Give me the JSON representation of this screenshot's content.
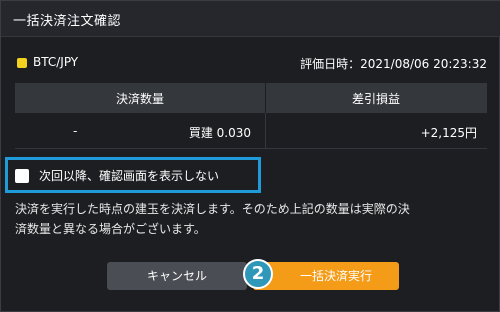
{
  "dialog": {
    "title": "一括決済注文確認"
  },
  "order": {
    "pair_color": "#f2d21e",
    "pair": "BTC/JPY",
    "valuation_time": "評価日時：2021/08/06 20:23:32"
  },
  "table": {
    "headers": [
      "決済数量",
      "差引損益"
    ],
    "row": {
      "dash": "-",
      "quantity": "買建 0.030",
      "profit_loss": "+2,125円"
    }
  },
  "option": {
    "checkbox_label": "次回以降、確認画面を表示しない",
    "checked": false,
    "highlight_color": "#1e9bd8"
  },
  "note": {
    "line1": "決済を実行した時点の建玉を決済します。そのため上記の数量は実際の決",
    "line2": "済数量と異なる場合がございます。"
  },
  "buttons": {
    "cancel_label": "キャンセル",
    "execute_label": "一括決済実行",
    "execute_color": "#f49b17"
  },
  "annotation": {
    "step_number": "2",
    "badge_color": "#2f97b8"
  }
}
